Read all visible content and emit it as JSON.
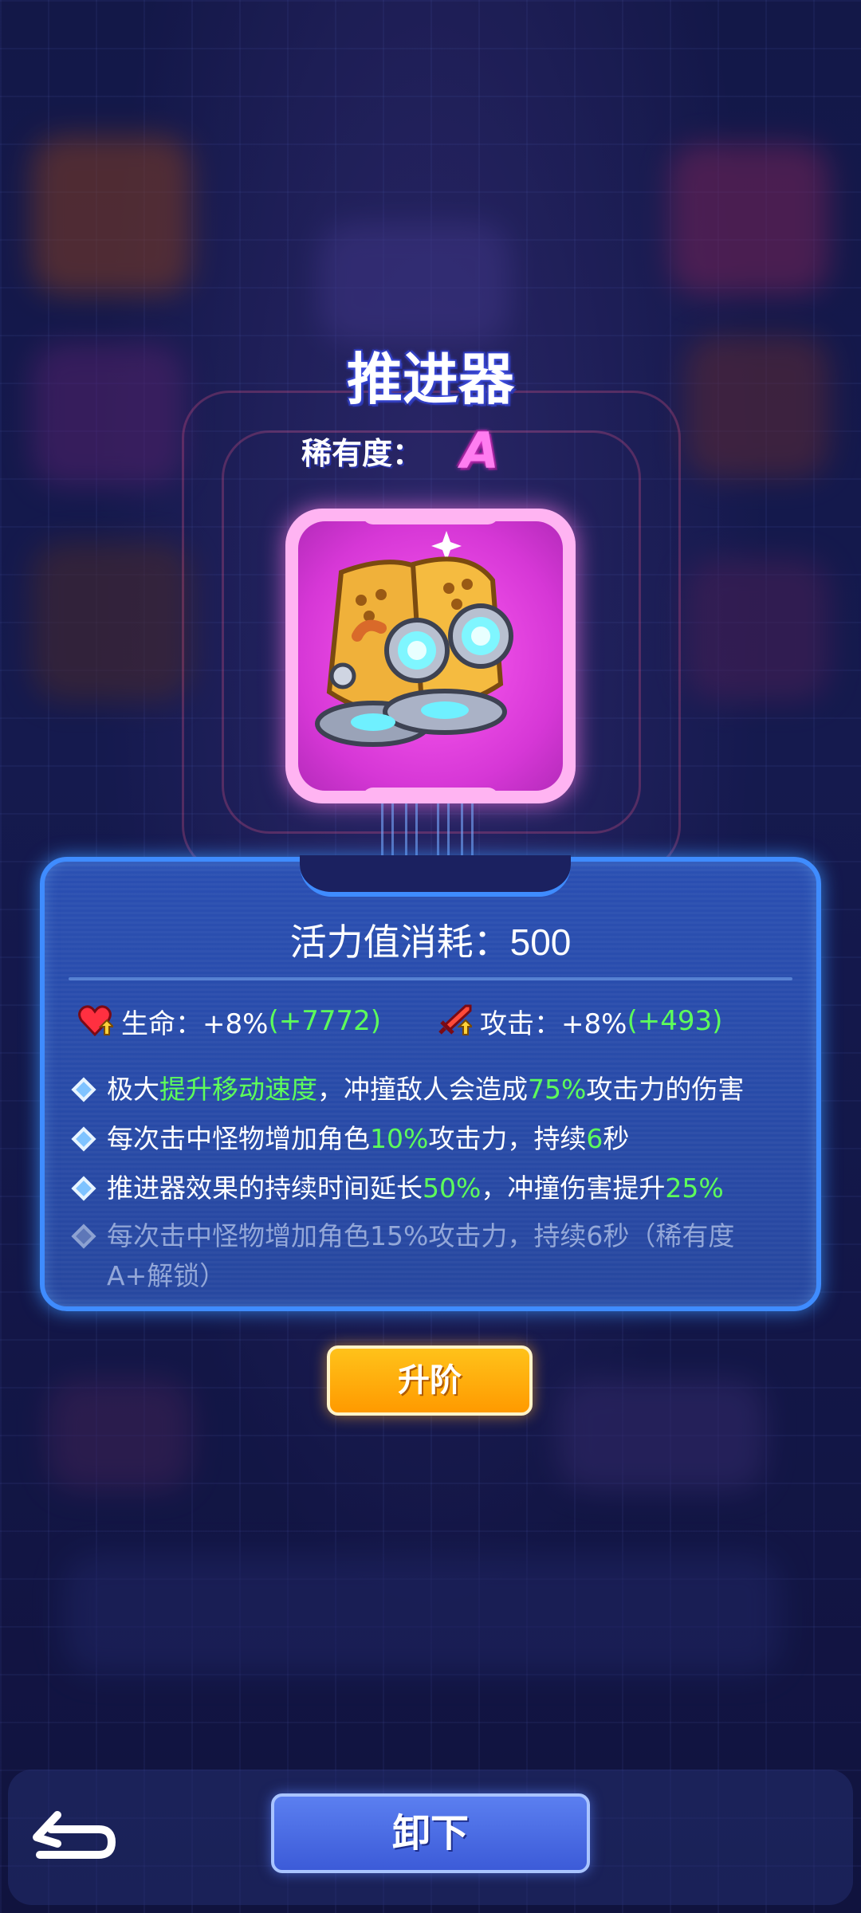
{
  "item": {
    "name": "推进器",
    "rarity_label": "稀有度：",
    "rarity": "A",
    "icon": "thruster-icon"
  },
  "details": {
    "stamina": "活力值消耗：500",
    "stats": [
      {
        "icon": "heart-up-icon",
        "label": "生命：+8%",
        "bonus": "(+7772)"
      },
      {
        "icon": "sword-up-icon",
        "label": "攻击：+8%",
        "bonus": "(+493)"
      }
    ],
    "skills": [
      {
        "parts": [
          "极大",
          "提升移动速度",
          "，冲撞敌人会造成",
          "75%",
          "攻击力的伤害"
        ]
      },
      {
        "parts": [
          "每次击中怪物增加角色",
          "10%",
          "攻击力，持续",
          "6",
          "秒"
        ]
      },
      {
        "parts": [
          "推进器效果的持续时间延长",
          "50%",
          "，冲撞伤害提升",
          "25%",
          ""
        ]
      },
      {
        "locked_text": "每次击中怪物增加角色15%攻击力，持续6秒（稀有度A+解锁）"
      }
    ]
  },
  "buttons": {
    "upgrade": "升阶",
    "unequip": "卸下",
    "back_icon": "back-arrow-icon"
  },
  "colors": {
    "highlight": "#5dff5a",
    "panel_border": "#3f8cff",
    "rarity": "#ff7df0",
    "upgrade_button": "#ffac0a"
  }
}
